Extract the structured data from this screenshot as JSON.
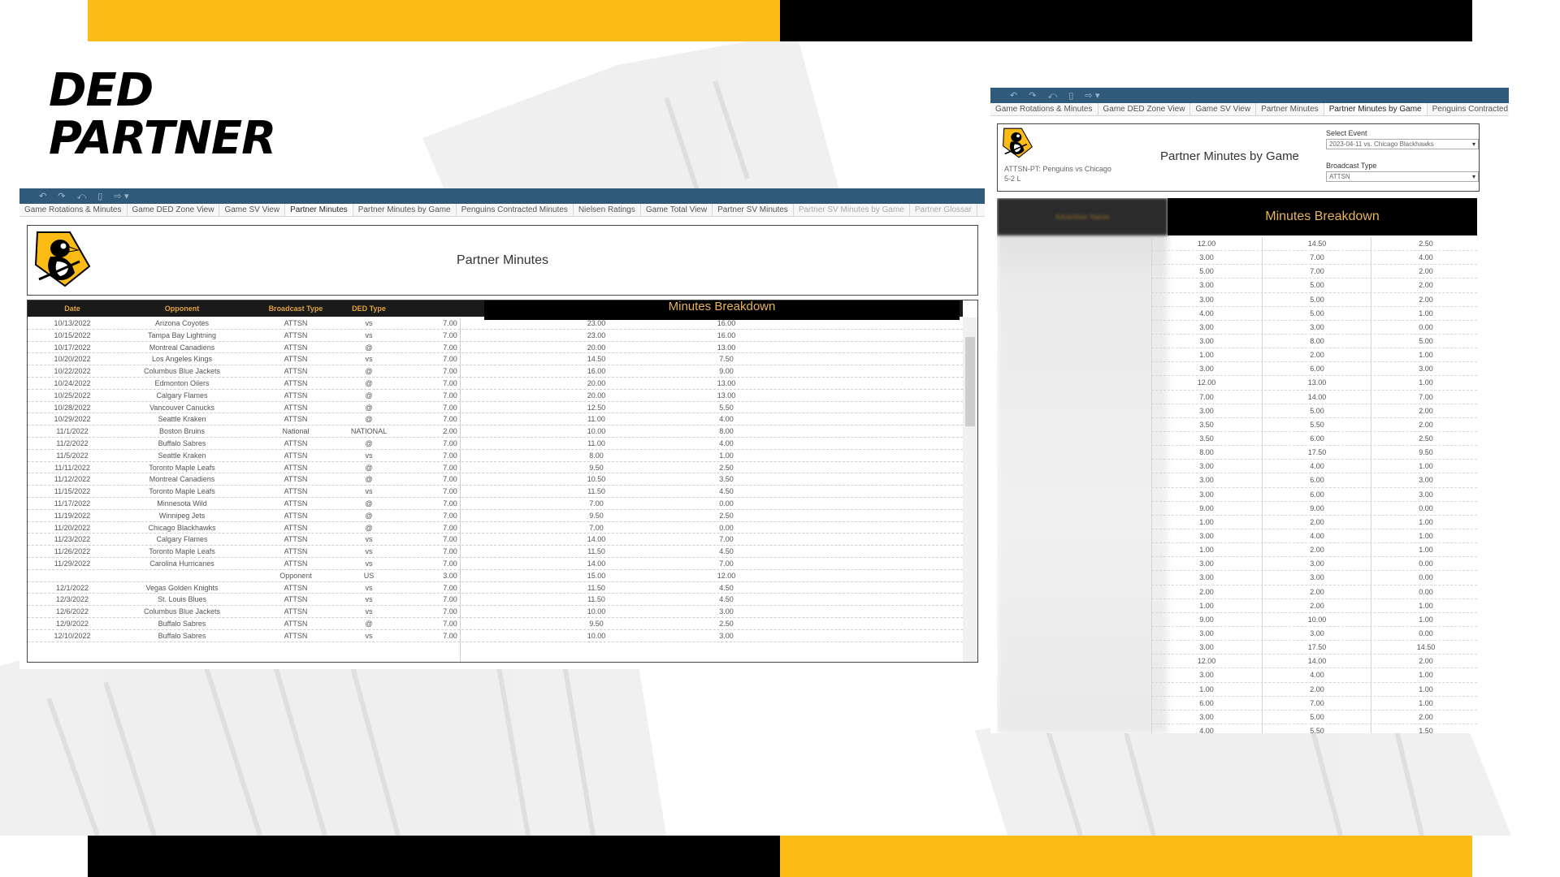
{
  "slide": {
    "headline_line1": "DED",
    "headline_line2": "PARTNER",
    "colors": {
      "gold": "#FDBB16",
      "black": "#000000",
      "toolbar": "#2F5A79",
      "header_text": "#E0A23E"
    }
  },
  "left_view": {
    "tabs": [
      "Game Rotations & Minutes",
      "Game DED Zone View",
      "Game SV View",
      "Partner Minutes",
      "Partner Minutes by Game",
      "Penguins Contracted Minutes",
      "Nielsen Ratings",
      "Game Total View",
      "Partner SV Minutes",
      "Partner SV Minutes by Game",
      "Partner Glossar"
    ],
    "active_tab": "Partner Minutes",
    "title": "Partner Minutes",
    "columns": [
      "Date",
      "Opponent",
      "Broadcast Type",
      "DED Type"
    ],
    "minutes_breakdown_label": "Minutes Breakdown",
    "rows": [
      [
        "10/13/2022",
        "Arizona Coyotes",
        "ATTSN",
        "vs",
        "7.00",
        "23.00",
        "16.00"
      ],
      [
        "10/15/2022",
        "Tampa Bay Lightning",
        "ATTSN",
        "vs",
        "7.00",
        "23.00",
        "16.00"
      ],
      [
        "10/17/2022",
        "Montreal Canadiens",
        "ATTSN",
        "@",
        "7.00",
        "20.00",
        "13.00"
      ],
      [
        "10/20/2022",
        "Los Angeles Kings",
        "ATTSN",
        "vs",
        "7.00",
        "14.50",
        "7.50"
      ],
      [
        "10/22/2022",
        "Columbus Blue Jackets",
        "ATTSN",
        "@",
        "7.00",
        "16.00",
        "9.00"
      ],
      [
        "10/24/2022",
        "Edmonton Oilers",
        "ATTSN",
        "@",
        "7.00",
        "20.00",
        "13.00"
      ],
      [
        "10/25/2022",
        "Calgary Flames",
        "ATTSN",
        "@",
        "7.00",
        "20.00",
        "13.00"
      ],
      [
        "10/28/2022",
        "Vancouver Canucks",
        "ATTSN",
        "@",
        "7.00",
        "12.50",
        "5.50"
      ],
      [
        "10/29/2022",
        "Seattle Kraken",
        "ATTSN",
        "@",
        "7.00",
        "11.00",
        "4.00"
      ],
      [
        "11/1/2022",
        "Boston Bruins",
        "National",
        "NATIONAL",
        "2.00",
        "10.00",
        "8.00"
      ],
      [
        "11/2/2022",
        "Buffalo Sabres",
        "ATTSN",
        "@",
        "7.00",
        "11.00",
        "4.00"
      ],
      [
        "11/5/2022",
        "Seattle Kraken",
        "ATTSN",
        "vs",
        "7.00",
        "8.00",
        "1.00"
      ],
      [
        "11/11/2022",
        "Toronto Maple Leafs",
        "ATTSN",
        "@",
        "7.00",
        "9.50",
        "2.50"
      ],
      [
        "11/12/2022",
        "Montreal Canadiens",
        "ATTSN",
        "@",
        "7.00",
        "10.50",
        "3.50"
      ],
      [
        "11/15/2022",
        "Toronto Maple Leafs",
        "ATTSN",
        "vs",
        "7.00",
        "11.50",
        "4.50"
      ],
      [
        "11/17/2022",
        "Minnesota Wild",
        "ATTSN",
        "@",
        "7.00",
        "7.00",
        "0.00"
      ],
      [
        "11/19/2022",
        "Winnipeg Jets",
        "ATTSN",
        "@",
        "7.00",
        "9.50",
        "2.50"
      ],
      [
        "11/20/2022",
        "Chicago Blackhawks",
        "ATTSN",
        "@",
        "7.00",
        "7.00",
        "0.00"
      ],
      [
        "11/23/2022",
        "Calgary Flames",
        "ATTSN",
        "vs",
        "7.00",
        "14.00",
        "7.00"
      ],
      [
        "11/26/2022",
        "Toronto Maple Leafs",
        "ATTSN",
        "vs",
        "7.00",
        "11.50",
        "4.50"
      ],
      [
        "11/29/2022",
        "Carolina Hurricanes",
        "ATTSN",
        "vs",
        "7.00",
        "14.00",
        "7.00"
      ],
      [
        "",
        "",
        "Opponent",
        "US",
        "3.00",
        "15.00",
        "12.00"
      ],
      [
        "12/1/2022",
        "Vegas Golden Knights",
        "ATTSN",
        "vs",
        "7.00",
        "11.50",
        "4.50"
      ],
      [
        "12/3/2022",
        "St. Louis Blues",
        "ATTSN",
        "vs",
        "7.00",
        "11.50",
        "4.50"
      ],
      [
        "12/6/2022",
        "Columbus Blue Jackets",
        "ATTSN",
        "vs",
        "7.00",
        "10.00",
        "3.00"
      ],
      [
        "12/9/2022",
        "Buffalo Sabres",
        "ATTSN",
        "@",
        "7.00",
        "9.50",
        "2.50"
      ],
      [
        "12/10/2022",
        "Buffalo Sabres",
        "ATTSN",
        "vs",
        "7.00",
        "10.00",
        "3.00"
      ]
    ]
  },
  "right_view": {
    "tabs": [
      "Game Rotations & Minutes",
      "Game DED Zone View",
      "Game SV View",
      "Partner Minutes",
      "Partner Minutes by Game",
      "Penguins Contracted"
    ],
    "active_tab": "Partner Minutes by Game",
    "title": "Partner Minutes by Game",
    "subtitle_line1": "ATTSN-PT: Penguins vs Chicago",
    "subtitle_line2": "5-2 L",
    "filters": {
      "event_label": "Select Event",
      "event_value": "2023-04-11 vs. Chicago Blackhawks",
      "broadcast_label": "Broadcast Type",
      "broadcast_value": "ATTSN"
    },
    "advertiser_header": "Advertiser Name",
    "minutes_breakdown_label": "Minutes Breakdown",
    "rows": [
      [
        "12.00",
        "14.50",
        "2.50"
      ],
      [
        "3.00",
        "7.00",
        "4.00"
      ],
      [
        "5.00",
        "7.00",
        "2.00"
      ],
      [
        "3.00",
        "5.00",
        "2.00"
      ],
      [
        "3.00",
        "5.00",
        "2.00"
      ],
      [
        "4.00",
        "5.00",
        "1.00"
      ],
      [
        "3.00",
        "3.00",
        "0.00"
      ],
      [
        "3.00",
        "8.00",
        "5.00"
      ],
      [
        "1.00",
        "2.00",
        "1.00"
      ],
      [
        "3.00",
        "6.00",
        "3.00"
      ],
      [
        "12.00",
        "13.00",
        "1.00"
      ],
      [
        "7.00",
        "14.00",
        "7.00"
      ],
      [
        "3.00",
        "5.00",
        "2.00"
      ],
      [
        "3.50",
        "5.50",
        "2.00"
      ],
      [
        "3.50",
        "6.00",
        "2.50"
      ],
      [
        "8.00",
        "17.50",
        "9.50"
      ],
      [
        "3.00",
        "4.00",
        "1.00"
      ],
      [
        "3.00",
        "6.00",
        "3.00"
      ],
      [
        "3.00",
        "6.00",
        "3.00"
      ],
      [
        "9.00",
        "9.00",
        "0.00"
      ],
      [
        "1.00",
        "2.00",
        "1.00"
      ],
      [
        "3.00",
        "4.00",
        "1.00"
      ],
      [
        "1.00",
        "2.00",
        "1.00"
      ],
      [
        "3.00",
        "3.00",
        "0.00"
      ],
      [
        "3.00",
        "3.00",
        "0.00"
      ],
      [
        "2.00",
        "2.00",
        "0.00"
      ],
      [
        "1.00",
        "2.00",
        "1.00"
      ],
      [
        "9.00",
        "10.00",
        "1.00"
      ],
      [
        "3.00",
        "3.00",
        "0.00"
      ],
      [
        "3.00",
        "17.50",
        "14.50"
      ],
      [
        "12.00",
        "14.00",
        "2.00"
      ],
      [
        "3.00",
        "4.00",
        "1.00"
      ],
      [
        "1.00",
        "2.00",
        "1.00"
      ],
      [
        "6.00",
        "7.00",
        "1.00"
      ],
      [
        "3.00",
        "5.00",
        "2.00"
      ],
      [
        "4.00",
        "5.50",
        "1.50"
      ]
    ]
  }
}
